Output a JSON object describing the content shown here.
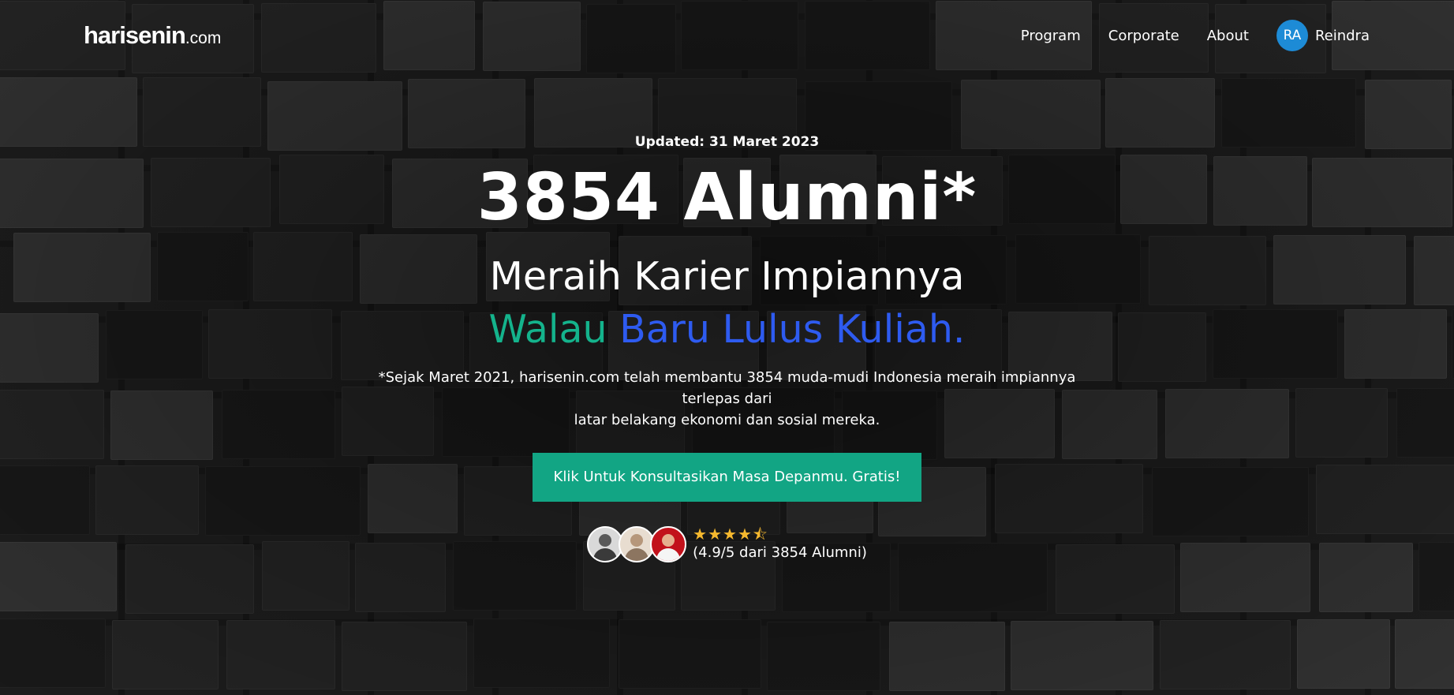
{
  "nav": {
    "logo_main": "harisenin",
    "logo_domain": ".com",
    "links": [
      "Program",
      "Corporate",
      "About"
    ],
    "user": {
      "initials": "RA",
      "name": "Reindra",
      "avatar_color": "#1d8bd6"
    }
  },
  "hero": {
    "updated": "Updated: 31 Maret 2023",
    "headline": "3854 Alumni*",
    "subheadline": "Meraih Karier Impiannya",
    "tagline_part1": "Walau",
    "tagline_part2": "Baru Lulus Kuliah.",
    "description_line1": "*Sejak Maret 2021, harisenin.com telah membantu 3854 muda-mudi Indonesia meraih impiannya terlepas dari",
    "description_line2": "latar belakang ekonomi dan sosial mereka.",
    "cta_label": "Klik Untuk Konsultasikan Masa Depanmu. Gratis!",
    "stars": "★★★★⯪",
    "rating_text": "(4.9/5 dari 3854 Alumni)"
  },
  "colors": {
    "accent_teal": "#14b38c",
    "accent_blue": "#2e5bf0",
    "cta_bg": "#12a584",
    "star": "#f5b82e"
  }
}
